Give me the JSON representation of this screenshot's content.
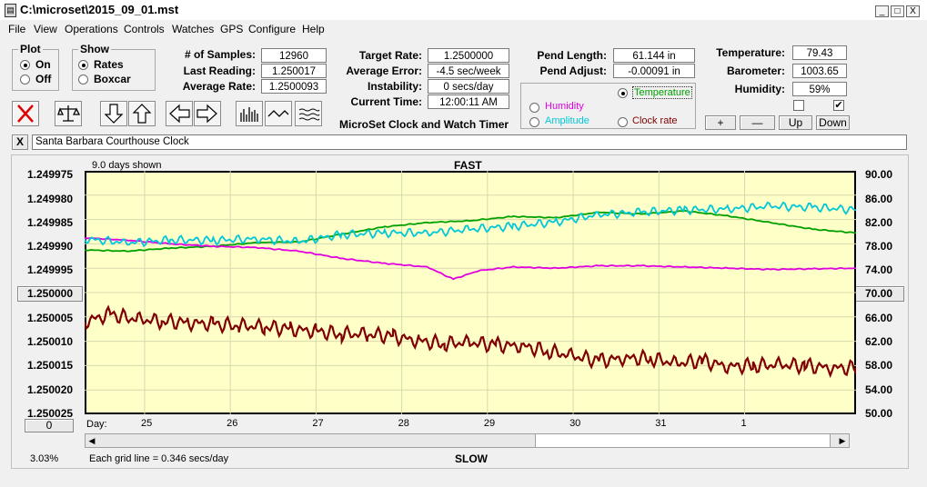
{
  "window": {
    "title": "C:\\microset\\2015_09_01.mst",
    "min_label": "_",
    "max_label": "□",
    "close_label": "X"
  },
  "menu": [
    "File",
    "View",
    "Operations",
    "Controls",
    "Watches",
    "GPS",
    "Configure",
    "Help"
  ],
  "plot_group": {
    "title": "Plot",
    "on_label": "On",
    "off_label": "Off",
    "selected": "On"
  },
  "show_group": {
    "title": "Show",
    "rates_label": "Rates",
    "boxcar_label": "Boxcar",
    "selected": "Rates"
  },
  "stats": {
    "samples_label": "# of Samples:",
    "samples_value": "12960",
    "last_label": "Last Reading:",
    "last_value": "1.250017",
    "avg_label": "Average Rate:",
    "avg_value": "1.2500093",
    "target_label": "Target Rate:",
    "target_value": "1.2500000",
    "avgerr_label": "Average Error:",
    "avgerr_value": "-4.5 sec/week",
    "instab_label": "Instability:",
    "instab_value": "0 secs/day",
    "curtime_label": "Current Time:",
    "curtime_value": "12:00:11 AM",
    "title_label": "MicroSet Clock and Watch Timer",
    "pendlen_label": "Pend Length:",
    "pendlen_value": "61.144 in",
    "pendadj_label": "Pend Adjust:",
    "pendadj_value": "-0.00091 in",
    "temp_label": "Temperature:",
    "temp_value": "79.43",
    "baro_label": "Barometer:",
    "baro_value": "1003.65",
    "humid_label": "Humidity:",
    "humid_value": "59%"
  },
  "sensor_select": {
    "temperature": "Temperature",
    "humidity": "Humidity",
    "amplitude": "Amplitude",
    "clock_rate": "Clock rate",
    "selected": "Temperature",
    "colors": {
      "temperature": "#00a000",
      "humidity": "#e000e0",
      "amplitude": "#00c8d8",
      "clock_rate": "#800000"
    }
  },
  "scale_buttons": {
    "plus": "+",
    "minus": "—",
    "up": "Up",
    "down": "Down",
    "check1": false,
    "check2": true
  },
  "toolbar_icons": [
    "close-x-icon",
    "balance-scale-icon",
    "arrow-down-icon",
    "arrow-up-icon",
    "arrow-left-icon",
    "arrow-right-icon",
    "bar-graph-icon",
    "wave-icon",
    "ripple-icon"
  ],
  "description": {
    "close_label": "X",
    "text": "Santa Barbara Courthouse Clock"
  },
  "chart_header": {
    "days_shown": "9.0 days shown",
    "fast": "FAST",
    "slow": "SLOW",
    "day_label": "Day:"
  },
  "left_buttons": {
    "center": "1.250000",
    "bottom": "0"
  },
  "right_button": "70.00",
  "footer": {
    "percent": "3.03%",
    "grid_info": "Each grid line = 0.346 secs/day"
  },
  "chart_data": {
    "type": "line",
    "x_label": "Day:",
    "x_ticks": [
      "25",
      "26",
      "27",
      "28",
      "29",
      "30",
      "31",
      "1"
    ],
    "x_range_days": [
      24.3,
      33.3
    ],
    "y_left_ticks": [
      "1.249975",
      "1.249980",
      "1.249985",
      "1.249990",
      "1.249995",
      "1.250000",
      "1.250005",
      "1.250010",
      "1.250015",
      "1.250020",
      "1.250025"
    ],
    "y_left_range": [
      1.249975,
      1.250025
    ],
    "y_left_reversed": true,
    "y_right_ticks": [
      "90.00",
      "86.00",
      "82.00",
      "78.00",
      "74.00",
      "70.00",
      "66.00",
      "62.00",
      "58.00",
      "54.00",
      "50.00"
    ],
    "y_right_range": [
      50,
      90
    ],
    "grid": true,
    "background": "#ffffc8",
    "series": [
      {
        "key": "temperature",
        "axis": "right",
        "color": "#00a000",
        "x": [
          24.3,
          24.8,
          25.3,
          25.8,
          26.3,
          26.8,
          27.3,
          27.8,
          28.3,
          28.8,
          29.3,
          29.8,
          30.3,
          30.8,
          31.3,
          31.8,
          32.3,
          32.8,
          33.3
        ],
        "y": [
          77.0,
          76.8,
          77.3,
          77.6,
          78.2,
          78.3,
          79.6,
          80.8,
          81.5,
          81.8,
          82.5,
          82.3,
          83.2,
          82.9,
          83.4,
          82.6,
          81.5,
          80.4,
          79.8
        ]
      },
      {
        "key": "humidity",
        "axis": "right",
        "color": "#e000e0",
        "x": [
          24.3,
          24.8,
          25.3,
          25.8,
          26.3,
          26.8,
          27.3,
          27.8,
          28.3,
          28.6,
          28.9,
          29.3,
          29.8,
          30.3,
          30.8,
          31.3,
          31.8,
          32.3,
          32.8,
          33.3
        ],
        "y": [
          79.0,
          78.6,
          78.0,
          77.6,
          77.4,
          76.8,
          75.6,
          74.8,
          74.2,
          72.2,
          73.6,
          74.2,
          74.0,
          74.4,
          74.4,
          74.2,
          74.0,
          73.8,
          73.9,
          74.0
        ]
      },
      {
        "key": "amplitude",
        "axis": "right",
        "color": "#00c8d8",
        "x": [
          24.3,
          24.8,
          25.3,
          25.8,
          26.3,
          26.8,
          27.3,
          27.8,
          28.3,
          28.8,
          29.3,
          29.8,
          30.3,
          30.8,
          31.3,
          31.8,
          32.3,
          32.8,
          33.3
        ],
        "y": [
          78.8,
          78.2,
          78.6,
          78.6,
          78.8,
          78.4,
          79.5,
          79.8,
          79.8,
          80.4,
          80.9,
          81.6,
          82.8,
          83.2,
          83.6,
          83.7,
          84.2,
          84.0,
          83.6
        ]
      },
      {
        "key": "clock_rate",
        "axis": "left",
        "color": "#800000",
        "x": [
          24.3,
          24.6,
          24.9,
          25.2,
          25.5,
          25.8,
          26.1,
          26.4,
          26.7,
          27.0,
          27.3,
          27.6,
          27.9,
          28.2,
          28.5,
          28.8,
          29.1,
          29.4,
          29.7,
          30.0,
          30.3,
          30.6,
          30.9,
          31.2,
          31.5,
          31.8,
          32.1,
          32.4,
          32.7,
          33.0,
          33.3
        ],
        "y": [
          1.250006,
          1.2500045,
          1.2500055,
          1.2500058,
          1.2500062,
          1.2500065,
          1.2500068,
          1.250007,
          1.2500075,
          1.250008,
          1.2500085,
          1.2500085,
          1.250009,
          1.25001,
          1.2500105,
          1.2500102,
          1.2500108,
          1.250011,
          1.250012,
          1.250013,
          1.250014,
          1.2500135,
          1.2500135,
          1.2500145,
          1.250014,
          1.2500152,
          1.250015,
          1.2500148,
          1.250015,
          1.2500155,
          1.2500155
        ]
      }
    ]
  }
}
